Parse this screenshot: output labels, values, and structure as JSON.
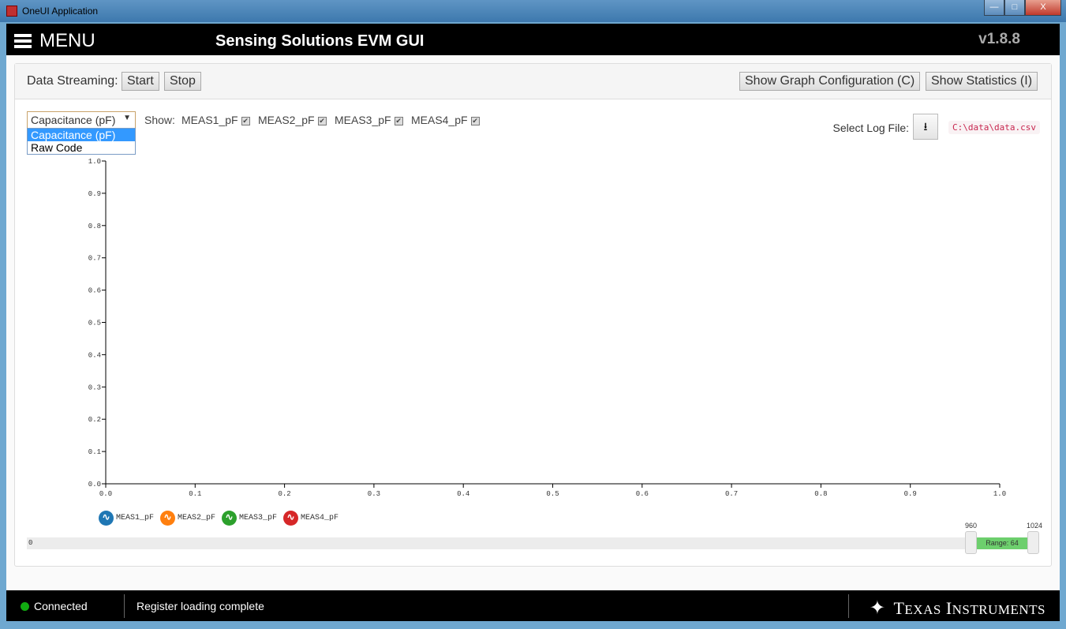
{
  "window": {
    "title": "OneUI Application",
    "minimize": "—",
    "maximize": "□",
    "close": "X"
  },
  "header": {
    "menu_label": "MENU",
    "app_title": "Sensing Solutions EVM GUI",
    "version": "v1.8.8"
  },
  "toolbar": {
    "streaming_label": "Data Streaming:",
    "start": "Start",
    "stop": "Stop",
    "graph_config": "Show Graph Configuration (C)",
    "statistics": "Show Statistics (I)"
  },
  "controls": {
    "unit_select": {
      "value": "Capacitance (pF)",
      "options": [
        "Capacitance (pF)",
        "Raw Code"
      ]
    },
    "show_label": "Show:",
    "channels": [
      {
        "label": "MEAS1_pF",
        "checked": true
      },
      {
        "label": "MEAS2_pF",
        "checked": true
      },
      {
        "label": "MEAS3_pF",
        "checked": true
      },
      {
        "label": "MEAS4_pF",
        "checked": true
      }
    ],
    "log_label": "Select Log File:",
    "log_path": "C:\\data\\data.csv",
    "download_icon": "download-icon"
  },
  "chart_data": {
    "type": "line",
    "xlim": [
      0,
      1
    ],
    "ylim": [
      0,
      1
    ],
    "x_ticks": [
      "0.0",
      "0.1",
      "0.2",
      "0.3",
      "0.4",
      "0.5",
      "0.6",
      "0.7",
      "0.8",
      "0.9",
      "1.0"
    ],
    "y_ticks": [
      "0.0",
      "0.1",
      "0.2",
      "0.3",
      "0.4",
      "0.5",
      "0.6",
      "0.7",
      "0.8",
      "0.9",
      "1.0"
    ],
    "grid": false,
    "legend": "bottom-left",
    "series": [
      {
        "name": "MEAS1_pF",
        "color": "#1f77b4",
        "values": []
      },
      {
        "name": "MEAS2_pF",
        "color": "#ff7f0e",
        "values": []
      },
      {
        "name": "MEAS3_pF",
        "color": "#2ca02c",
        "values": []
      },
      {
        "name": "MEAS4_pF",
        "color": "#d62728",
        "values": []
      }
    ]
  },
  "range_slider": {
    "min_label": "0",
    "low": "960",
    "high": "1024",
    "range_label": "Range: 64"
  },
  "footer": {
    "status_connected": "Connected",
    "message": "Register loading complete",
    "brand": "Texas Instruments"
  }
}
